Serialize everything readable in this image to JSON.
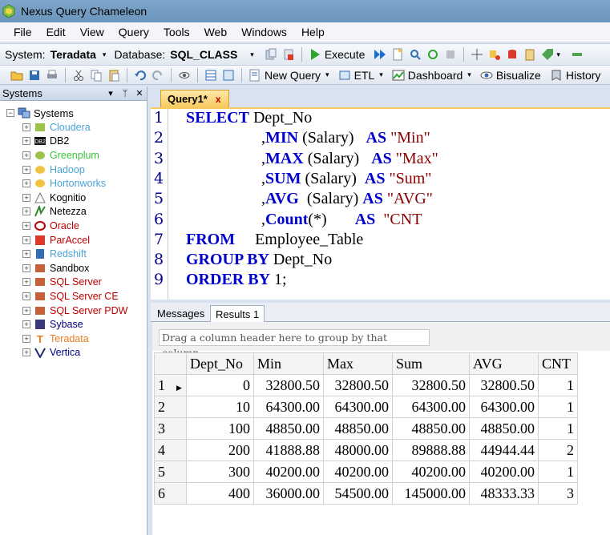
{
  "window": {
    "title": "Nexus Query Chameleon"
  },
  "menu": [
    "File",
    "Edit",
    "View",
    "Query",
    "Tools",
    "Web",
    "Windows",
    "Help"
  ],
  "toolbar1": {
    "system_label": "System:",
    "system_value": "Teradata",
    "database_label": "Database:",
    "database_value": "SQL_CLASS",
    "execute_label": "Execute"
  },
  "toolbar2": {
    "new_query": "New Query",
    "etl": "ETL",
    "dashboard": "Dashboard",
    "bisualize": "Bisualize",
    "history": "History"
  },
  "left_panel": {
    "title": "Systems",
    "root": "Systems",
    "items": [
      {
        "label": "Cloudera",
        "color": "#4aa3d6"
      },
      {
        "label": "DB2",
        "color": "#000000"
      },
      {
        "label": "Greenplum",
        "color": "#3cc23c"
      },
      {
        "label": "Hadoop",
        "color": "#4aa3d6"
      },
      {
        "label": "Hortonworks",
        "color": "#4aa3d6"
      },
      {
        "label": "Kognitio",
        "color": "#000000"
      },
      {
        "label": "Netezza",
        "color": "#000000"
      },
      {
        "label": "Oracle",
        "color": "#c00000"
      },
      {
        "label": "ParAccel",
        "color": "#c00000"
      },
      {
        "label": "Redshift",
        "color": "#4aa3d6"
      },
      {
        "label": "Sandbox",
        "color": "#000000"
      },
      {
        "label": "SQL Server",
        "color": "#c00000"
      },
      {
        "label": "SQL Server CE",
        "color": "#c00000"
      },
      {
        "label": "SQL Server PDW",
        "color": "#c00000"
      },
      {
        "label": "Sybase",
        "color": "#000080"
      },
      {
        "label": "Teradata",
        "color": "#e87a1f"
      },
      {
        "label": "Vertica",
        "color": "#000080"
      }
    ]
  },
  "editor": {
    "tab_label": "Query1*",
    "tab_close": "x",
    "line_numbers": [
      "1",
      "2",
      "3",
      "4",
      "5",
      "6",
      "7",
      "8",
      "9"
    ],
    "code": {
      "l1_kw": "SELECT",
      "l1_rest": " Dept_No",
      "l2_pre": ",",
      "l2_fn": "MIN",
      "l2_arg": " (Salary)   ",
      "l2_as": "AS",
      "l2_alias": " \"Min\"",
      "l3_pre": ",",
      "l3_fn": "MAX",
      "l3_arg": " (Salary)   ",
      "l3_as": "AS",
      "l3_alias": " \"Max\"",
      "l4_pre": ",",
      "l4_fn": "SUM",
      "l4_arg": " (Salary)  ",
      "l4_as": "AS",
      "l4_alias": " \"Sum\"",
      "l5_pre": ",",
      "l5_fn": "AVG",
      "l5_arg": "  (Salary) ",
      "l5_as": "AS",
      "l5_alias": " \"AVG\"",
      "l6_pre": ",",
      "l6_fn": "Count",
      "l6_arg": "(*)       ",
      "l6_as": "AS",
      "l6_alias": "  \"CNT",
      "l7_kw": "FROM",
      "l7_rest": "     Employee_Table",
      "l8_kw": "GROUP BY",
      "l8_rest": " Dept_No",
      "l9_kw": "ORDER BY",
      "l9_rest": " 1;"
    }
  },
  "result_tabs": {
    "messages": "Messages",
    "results": "Results 1"
  },
  "results": {
    "group_hint": "Drag a column header here to group by that column.",
    "columns": [
      "Dept_No",
      "Min",
      "Max",
      "Sum",
      "AVG",
      "CNT"
    ],
    "rows": [
      {
        "n": "1",
        "cells": [
          "0",
          "32800.50",
          "32800.50",
          "32800.50",
          "32800.50",
          "1"
        ]
      },
      {
        "n": "2",
        "cells": [
          "10",
          "64300.00",
          "64300.00",
          "64300.00",
          "64300.00",
          "1"
        ]
      },
      {
        "n": "3",
        "cells": [
          "100",
          "48850.00",
          "48850.00",
          "48850.00",
          "48850.00",
          "1"
        ]
      },
      {
        "n": "4",
        "cells": [
          "200",
          "41888.88",
          "48000.00",
          "89888.88",
          "44944.44",
          "2"
        ]
      },
      {
        "n": "5",
        "cells": [
          "300",
          "40200.00",
          "40200.00",
          "40200.00",
          "40200.00",
          "1"
        ]
      },
      {
        "n": "6",
        "cells": [
          "400",
          "36000.00",
          "54500.00",
          "145000.00",
          "48333.33",
          "3"
        ]
      }
    ]
  }
}
